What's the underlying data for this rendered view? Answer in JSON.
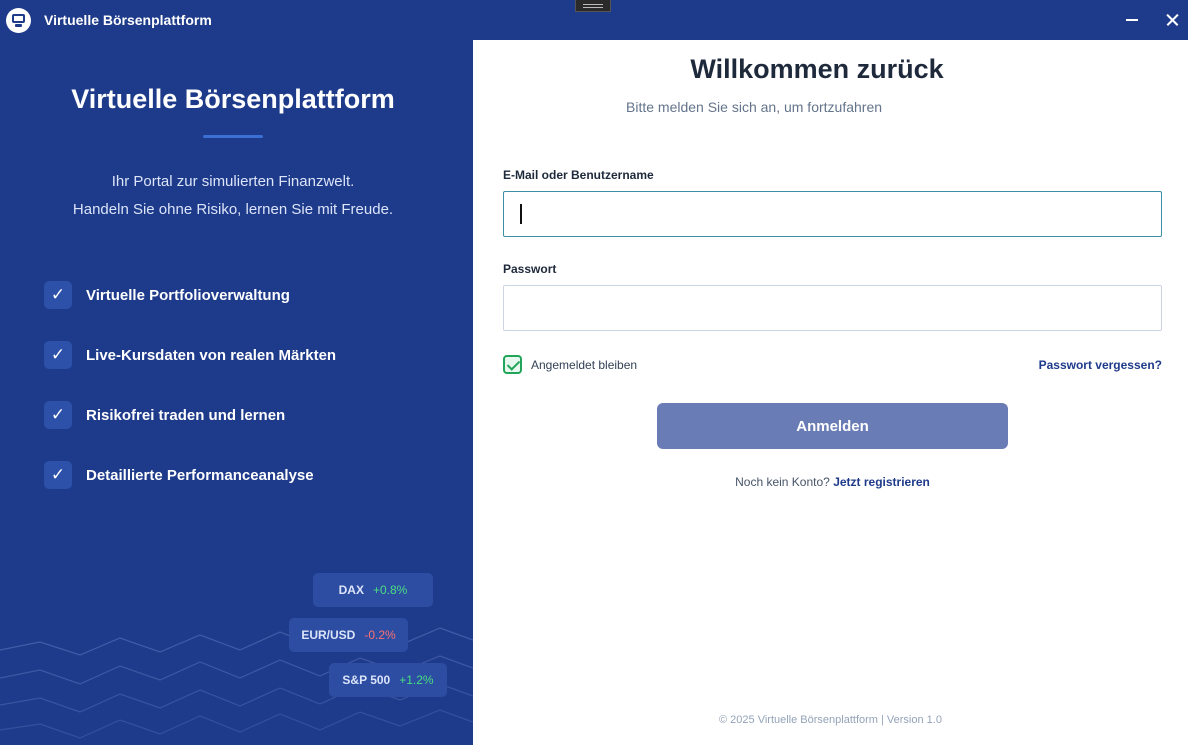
{
  "window": {
    "title": "Virtuelle Börsenplattform",
    "app_icon": "monitor-icon",
    "controls": [
      "minimize-icon",
      "close-icon"
    ]
  },
  "left": {
    "title": "Virtuelle Börsenplattform",
    "tagline_line1": "Ihr Portal zur simulierten Finanzwelt.",
    "tagline_line2": "Handeln Sie ohne Risiko, lernen Sie mit Freude.",
    "check_glyph": "✓",
    "features": [
      "Virtuelle Portfolioverwaltung",
      "Live-Kursdaten von realen Märkten",
      "Risikofrei traden und lernen",
      "Detaillierte Performanceanalyse"
    ],
    "tickers": [
      {
        "symbol": "DAX",
        "change": "+0.8%",
        "color": "#4ade80"
      },
      {
        "symbol": "EUR/USD",
        "change": "-0.2%",
        "color": "#f87171"
      },
      {
        "symbol": "S&P 500",
        "change": "+1.2%",
        "color": "#4ade80"
      }
    ]
  },
  "login": {
    "heading": "Willkommen zurück",
    "subtitle": "Bitte melden Sie sich an, um fortzufahren",
    "email_label": "E-Mail oder Benutzername",
    "email_value": "",
    "password_label": "Passwort",
    "password_value": "",
    "remember_label": "Angemeldet bleiben",
    "remember_checked": true,
    "forgot_label": "Passwort vergessen?",
    "submit_label": "Anmelden",
    "no_account_text": "Noch kein Konto?",
    "register_label": "Jetzt registrieren"
  },
  "footer": {
    "text": "© 2025 Virtuelle Börsenplattform | Version 1.0"
  },
  "colors": {
    "brand": "#1e3a8a",
    "button": "#6a7cb5",
    "positive": "#4ade80",
    "negative": "#f87171",
    "checkbox": "#22a55a"
  }
}
